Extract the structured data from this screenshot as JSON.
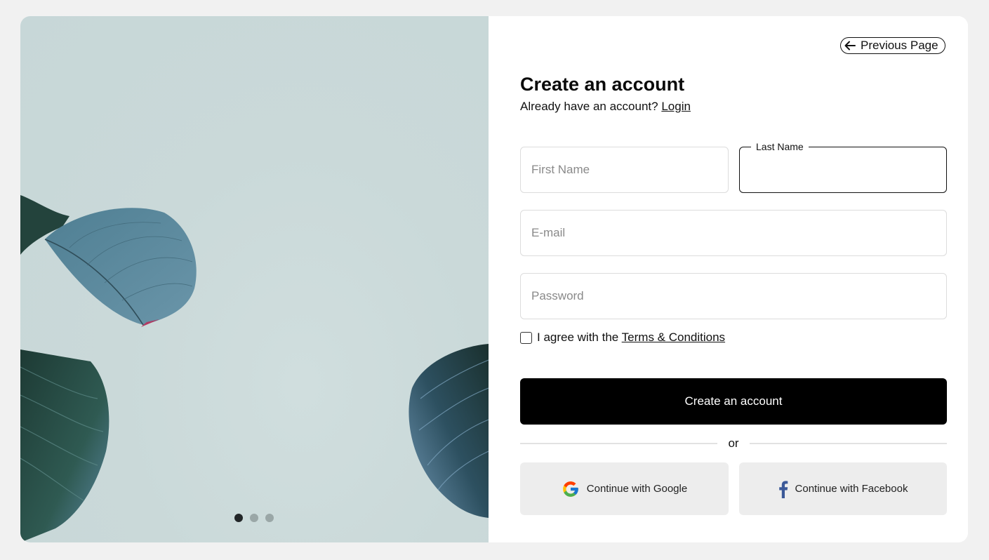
{
  "hero": {
    "carousel_dots": [
      {
        "active": true
      },
      {
        "active": false
      },
      {
        "active": false
      }
    ]
  },
  "nav": {
    "previous_label": "Previous Page"
  },
  "form": {
    "title": "Create an account",
    "subtitle_text": "Already have an account?",
    "login_link": "Login",
    "first_name": {
      "placeholder": "First Name",
      "value": ""
    },
    "last_name": {
      "label": "Last Name",
      "value": ""
    },
    "email": {
      "placeholder": "E-mail",
      "value": ""
    },
    "password": {
      "placeholder": "Password",
      "value": ""
    },
    "agree_text": "I agree with the",
    "terms_link": "Terms & Conditions",
    "agree_checked": false,
    "submit_label": "Create an account",
    "divider_text": "or",
    "google_label": "Continue with Google",
    "facebook_label": "Continue with Facebook"
  },
  "colors": {
    "page_bg": "#f1f1f1",
    "hero_bg": "#c9d8d9",
    "primary": "#000000",
    "social_bg": "#ededed",
    "facebook_blue": "#3b5998"
  }
}
